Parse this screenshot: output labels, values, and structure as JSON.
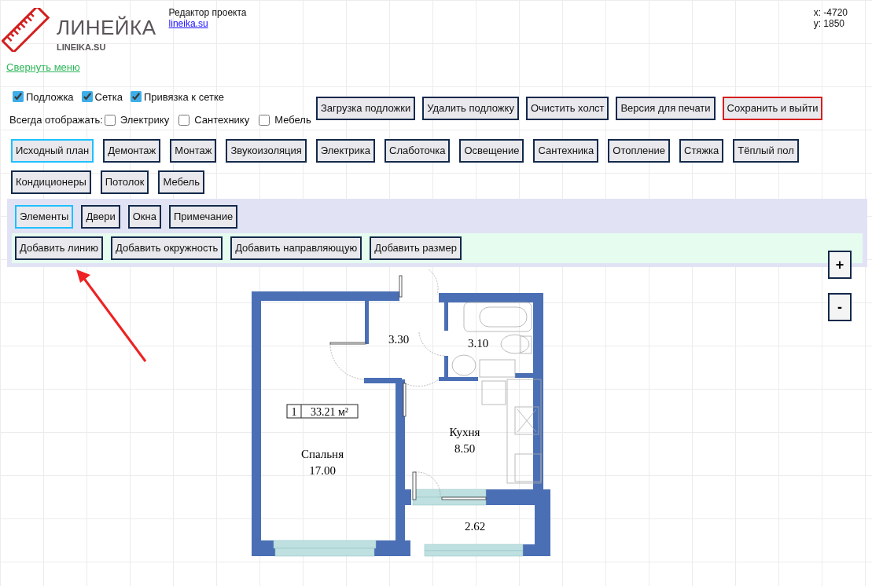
{
  "header": {
    "logo_title": "ЛИНЕЙКА",
    "logo_subtitle": "LINEIKA.SU",
    "editor_label": "Редактор проекта",
    "site_link": "lineika.su",
    "coord_x": "x: -4720",
    "coord_y": "y: 1850"
  },
  "collapse_link": "Свернуть меню",
  "toggles": [
    {
      "label": "Подложка",
      "checked": true
    },
    {
      "label": "Сетка",
      "checked": true
    },
    {
      "label": "Привязка к сетке",
      "checked": true
    }
  ],
  "always_show": {
    "label": "Всегда отображать:",
    "options": [
      {
        "label": "Электрику",
        "checked": false
      },
      {
        "label": "Сантехнику",
        "checked": false
      },
      {
        "label": "Мебель",
        "checked": false
      }
    ]
  },
  "actions": [
    {
      "label": "Загрузка подложки",
      "kind": "normal"
    },
    {
      "label": "Удалить подложку",
      "kind": "normal"
    },
    {
      "label": "Очистить холст",
      "kind": "normal"
    },
    {
      "label": "Версия для печати",
      "kind": "normal"
    },
    {
      "label": "Сохранить и выйти",
      "kind": "save"
    }
  ],
  "layers": [
    {
      "label": "Исходный план",
      "selected": true
    },
    {
      "label": "Демонтаж",
      "selected": false
    },
    {
      "label": "Монтаж",
      "selected": false
    },
    {
      "label": "Звукоизоляция",
      "selected": false
    },
    {
      "label": "Электрика",
      "selected": false
    },
    {
      "label": "Слаботочка",
      "selected": false
    },
    {
      "label": "Освещение",
      "selected": false
    },
    {
      "label": "Сантехника",
      "selected": false
    },
    {
      "label": "Отопление",
      "selected": false
    },
    {
      "label": "Стяжка",
      "selected": false
    },
    {
      "label": "Тёплый пол",
      "selected": false
    },
    {
      "label": "Кондиционеры",
      "selected": false
    },
    {
      "label": "Потолок",
      "selected": false
    },
    {
      "label": "Мебель",
      "selected": false
    }
  ],
  "sub_tabs": [
    {
      "label": "Элементы",
      "selected": true
    },
    {
      "label": "Двери",
      "selected": false
    },
    {
      "label": "Окна",
      "selected": false
    },
    {
      "label": "Примечание",
      "selected": false
    }
  ],
  "tools": [
    "Добавить линию",
    "Добавить окружность",
    "Добавить направляющую",
    "Добавить размер"
  ],
  "zoom_buttons": [
    "+",
    "-"
  ],
  "plan": {
    "area_number": "1",
    "total_area": "33.21 м²",
    "rooms": [
      {
        "area": "3.30"
      },
      {
        "area": "3.10"
      },
      {
        "name": "Кухня",
        "area": "8.50"
      },
      {
        "name": "Спальня",
        "area": "17.00"
      },
      {
        "area": "2.62"
      }
    ]
  }
}
